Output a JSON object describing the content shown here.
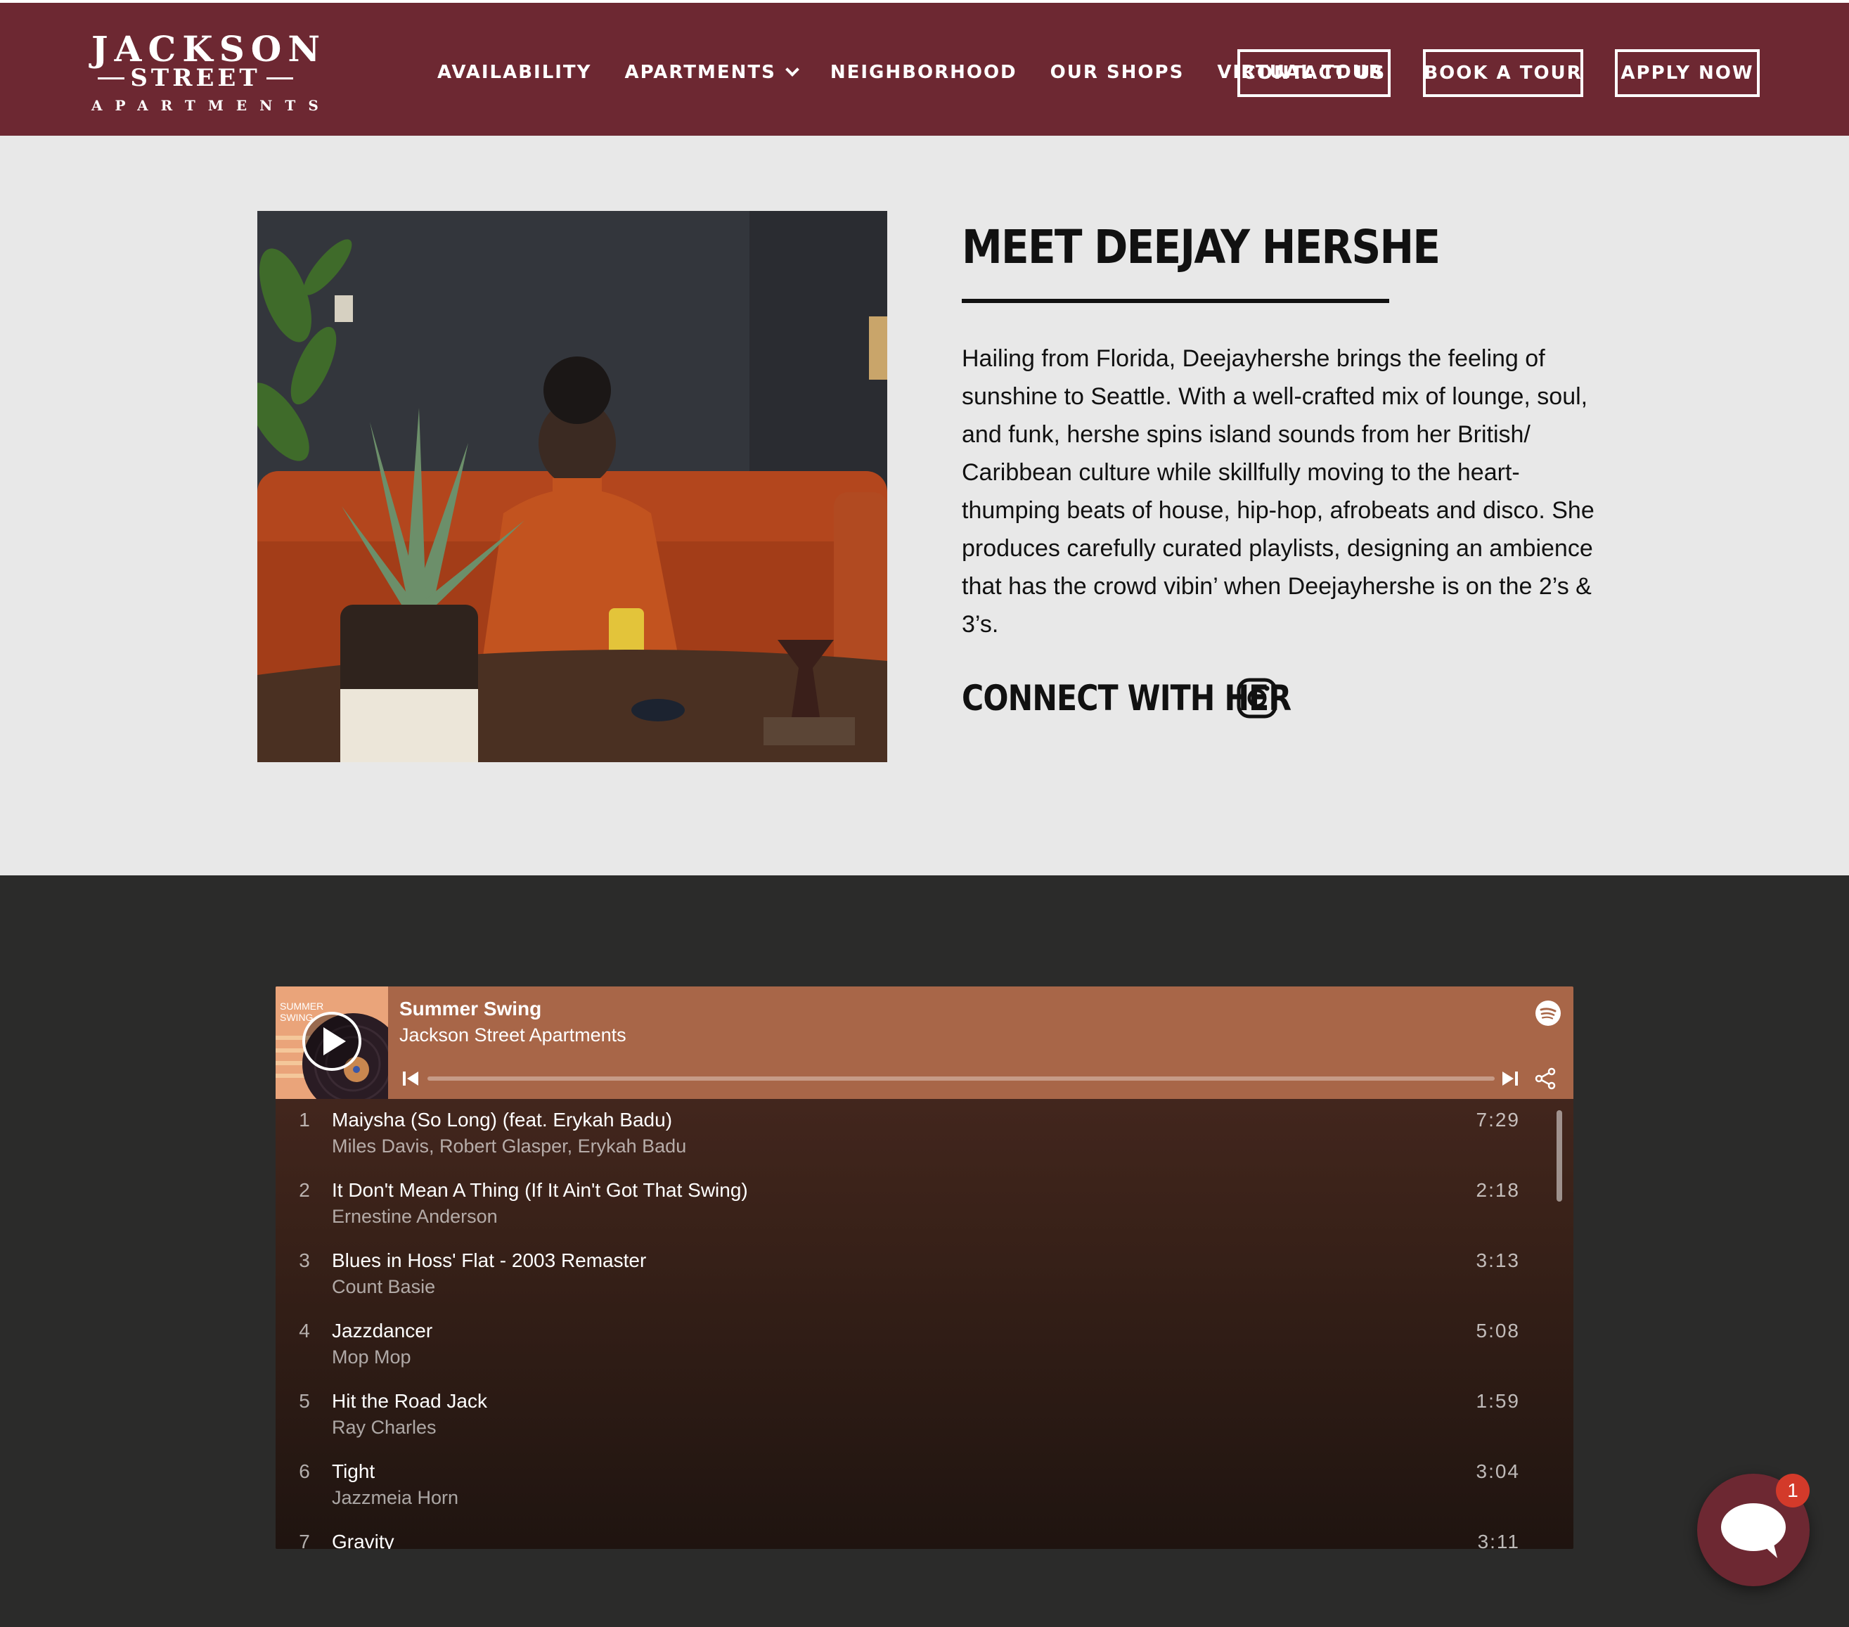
{
  "logo": {
    "line1": "JACKSON",
    "line2": "STREET",
    "line3": "APARTMENTS"
  },
  "nav": {
    "items": [
      {
        "label": "AVAILABILITY"
      },
      {
        "label": "APARTMENTS"
      },
      {
        "label": "NEIGHBORHOOD"
      },
      {
        "label": "OUR SHOPS"
      },
      {
        "label": "VIRTUAL TOUR"
      }
    ],
    "buttons": {
      "contact": "CONTACT US",
      "book": "BOOK A TOUR",
      "apply": "APPLY NOW"
    }
  },
  "meet": {
    "title": "MEET DEEJAY HERSHE",
    "body": "Hailing from Florida, Deejayhershe brings the feeling of sunshine to Seattle. With a well-crafted mix of lounge, soul, and funk, hershe spins island sounds from her British/ Caribbean culture while skillfully moving to the heart-thumping beats of house, hip-hop, afrobeats and disco. She produces carefully curated playlists, designing an ambience that has the crowd vibin’ when Deejayhershe is on the 2’s & 3’s.",
    "connect_label": "CONNECT WITH HER",
    "connect_icon": "instagram-icon"
  },
  "player": {
    "cover_text": "SUMMER SWING",
    "title": "Summer Swing",
    "subtitle": "Jackson Street Apartments",
    "tracks": [
      {
        "num": "1",
        "name": "Maiysha (So Long) (feat. Erykah Badu)",
        "artist": "Miles Davis, Robert Glasper, Erykah Badu",
        "duration": "7:29"
      },
      {
        "num": "2",
        "name": "It Don't Mean A Thing (If It Ain't Got That Swing)",
        "artist": "Ernestine Anderson",
        "duration": "2:18"
      },
      {
        "num": "3",
        "name": "Blues in Hoss' Flat - 2003 Remaster",
        "artist": "Count Basie",
        "duration": "3:13"
      },
      {
        "num": "4",
        "name": "Jazzdancer",
        "artist": "Mop Mop",
        "duration": "5:08"
      },
      {
        "num": "5",
        "name": "Hit the Road Jack",
        "artist": "Ray Charles",
        "duration": "1:59"
      },
      {
        "num": "6",
        "name": "Tight",
        "artist": "Jazzmeia Horn",
        "duration": "3:04"
      },
      {
        "num": "7",
        "name": "Gravity",
        "artist": "",
        "duration": "3:11"
      }
    ]
  },
  "chat": {
    "badge": "1"
  },
  "colors": {
    "header_bg": "#6d2832",
    "dark_bg": "#2b2b2a",
    "player_top": "#a86648"
  }
}
